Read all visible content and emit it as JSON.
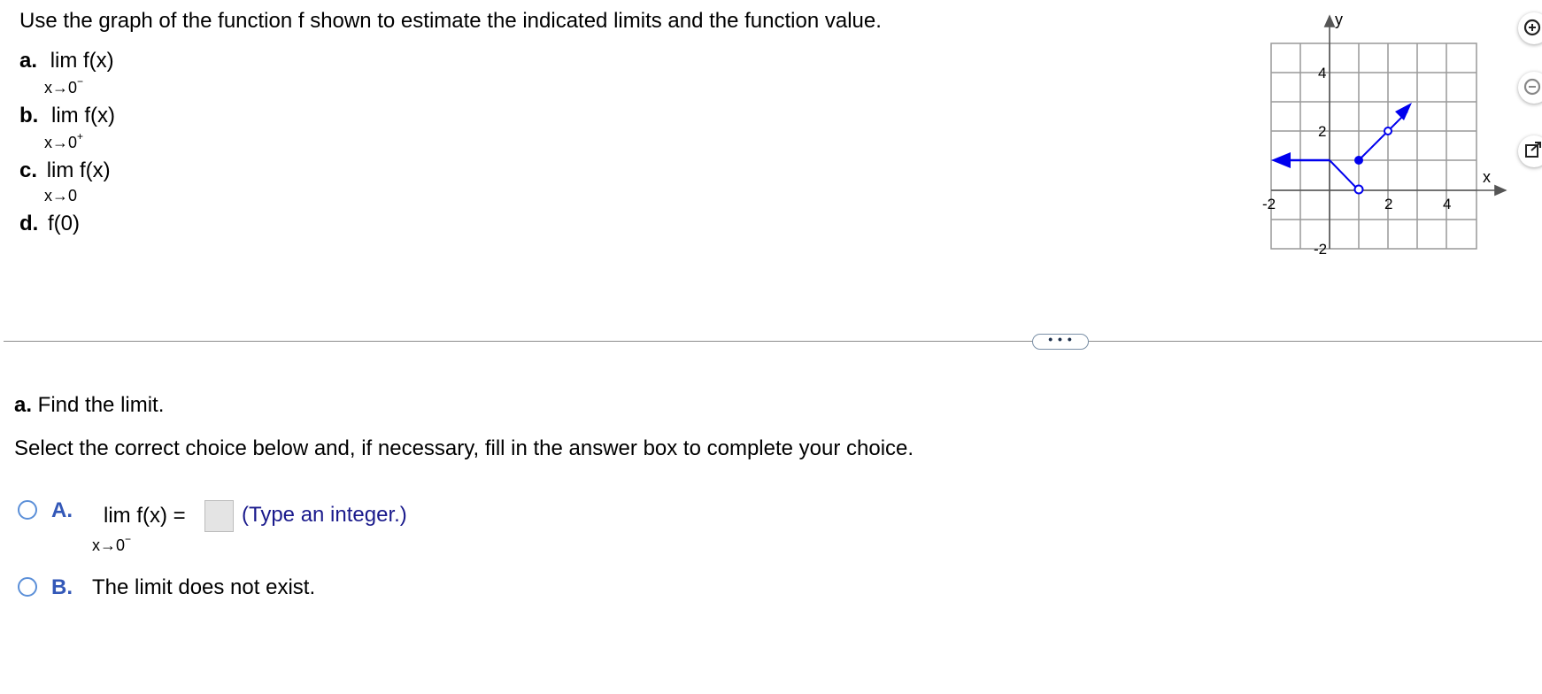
{
  "question": {
    "prompt": "Use the graph of the function f shown to estimate the indicated limits and the function value.",
    "items": [
      {
        "letter": "a.",
        "expr": "lim  f(x)",
        "sub": "x→0",
        "sup": "−"
      },
      {
        "letter": "b.",
        "expr": "lim  f(x)",
        "sub": "x→0",
        "sup": "+"
      },
      {
        "letter": "c.",
        "expr": "lim  f(x)",
        "sub": "x→0",
        "sup": ""
      },
      {
        "letter": "d.",
        "expr": "f(0)"
      }
    ]
  },
  "graph": {
    "x_axis_label": "x",
    "y_axis_label": "y",
    "x_ticks": [
      "-2",
      "2",
      "4"
    ],
    "y_ticks": [
      "4",
      "2",
      "-2"
    ],
    "curve_color": "#0000ee",
    "grid_color": "#999999"
  },
  "side_tools": [
    "zoom-in-icon",
    "zoom-out-icon",
    "open-external-icon"
  ],
  "divider": {
    "more_label": "• • •"
  },
  "part_a": {
    "title_bold": "a.",
    "title": " Find the limit.",
    "instruction": "Select the correct choice below and, if necessary, fill in the answer box to complete your choice.",
    "choices": [
      {
        "letter": "A.",
        "expr": "lim  f(x) =",
        "sub": "x→0",
        "sup": "−",
        "hint": "(Type an integer.)"
      },
      {
        "letter": "B.",
        "text": "The limit does not exist."
      }
    ]
  }
}
